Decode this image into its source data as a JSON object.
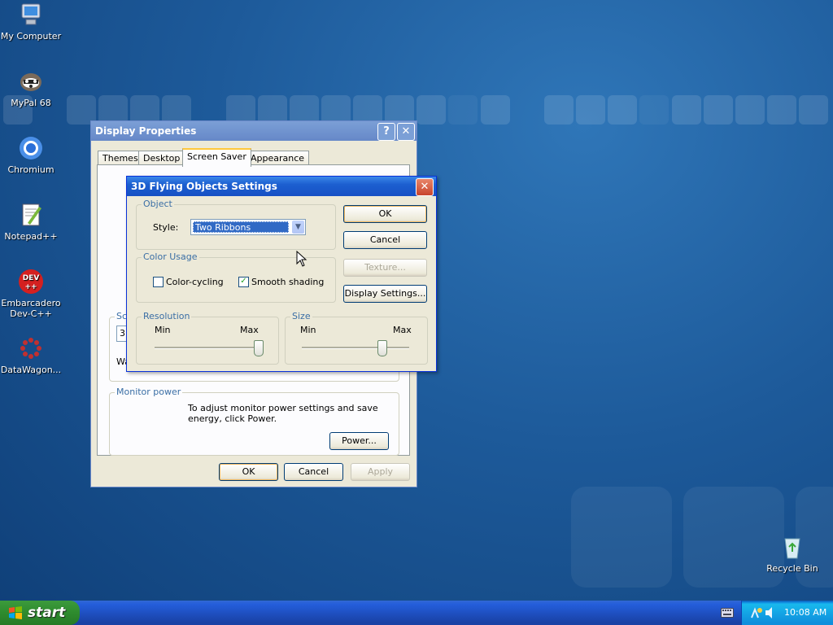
{
  "desktop": {
    "icons": [
      {
        "label": "My Computer",
        "icon": "computer-icon"
      },
      {
        "label": "MyPal 68",
        "icon": "mypal-icon"
      },
      {
        "label": "Chromium",
        "icon": "chromium-icon"
      },
      {
        "label": "Notepad++",
        "icon": "notepadpp-icon"
      },
      {
        "label": "Embarcadero Dev-C++",
        "icon": "devcpp-icon",
        "badge": "DEV\n++"
      },
      {
        "label": "DataWagon...",
        "icon": "datawagon-icon"
      },
      {
        "label": "Recycle Bin",
        "icon": "recycle-bin-icon"
      }
    ]
  },
  "display_properties": {
    "title": "Display Properties",
    "help_glyph": "?",
    "close_glyph": "✕",
    "tabs": [
      "Themes",
      "Desktop",
      "Screen Saver",
      "Appearance"
    ],
    "selected_tab": "Screen Saver",
    "screen_saver_group_partial": "Sc",
    "screen_saver_field_partial": "3I",
    "wait_partial": "Wa",
    "monitor_power": {
      "title": "Monitor power",
      "text": "To adjust monitor power settings and save energy, click Power.",
      "power_button": "Power..."
    },
    "buttons": {
      "ok": "OK",
      "cancel": "Cancel",
      "apply": "Apply"
    }
  },
  "flying_objects": {
    "title": "3D Flying Objects Settings",
    "close_glyph": "✕",
    "object_group": "Object",
    "style_label": "Style:",
    "style_value": "Two Ribbons",
    "color_group": "Color Usage",
    "color_cycling": {
      "label": "Color-cycling",
      "checked": false
    },
    "smooth_shading": {
      "label": "Smooth shading",
      "checked": true
    },
    "resolution": {
      "title": "Resolution",
      "min": "Min",
      "max": "Max",
      "value": 1.0
    },
    "size": {
      "title": "Size",
      "min": "Min",
      "max": "Max",
      "value": 0.75
    },
    "buttons": {
      "ok": "OK",
      "cancel": "Cancel",
      "texture": "Texture...",
      "display_settings": "Display Settings..."
    }
  },
  "taskbar": {
    "start_label": "start",
    "clock": "10:08 AM"
  },
  "colors": {
    "desktop_blue": "#1d5a9a",
    "title_blue": "#1c5fd0",
    "start_green": "#2e8b2e",
    "group_title": "#3a6ea5",
    "focus_orange": "#ffc83c"
  }
}
